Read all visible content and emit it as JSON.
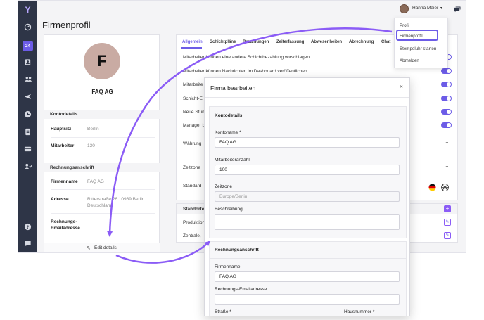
{
  "colors": {
    "accent": "#6c5ce7",
    "sidebar": "#2e3547",
    "arrow": "#8b5cf6"
  },
  "sidebar": {
    "icons": [
      "logo-icon",
      "dashboard-icon",
      "calendar-icon",
      "id-card-icon",
      "users-icon",
      "plane-icon",
      "clock-icon",
      "document-icon",
      "wallet-icon",
      "user-check-icon",
      "help-icon",
      "chat-icon"
    ],
    "calendar_label": "24"
  },
  "header": {
    "title": "Firmenprofil",
    "user_name": "Hanna Maier"
  },
  "user_menu": {
    "items": [
      "Profil",
      "Firmenprofil",
      "Stempeluhr starten",
      "Abmelden"
    ]
  },
  "profile": {
    "avatar_letter": "F",
    "company_name": "FAQ AG",
    "kontodetails": {
      "title": "Kontodetails",
      "rows": [
        {
          "key": "Hauptsitz",
          "value": "Berlin"
        },
        {
          "key": "Mitarbeiter",
          "value": "130"
        }
      ]
    },
    "rechnungsanschrift": {
      "title": "Rechnungsanschrift",
      "firmenname_key": "Firmenname",
      "firmenname_value": "FAQ AG",
      "adresse_key": "Adresse",
      "adresse_line1": "Ritterstraße 26 10969 Berlin",
      "adresse_line2": "Deutschland",
      "email_key_line1": "Rechnungs-",
      "email_key_line2": "Emailadresse"
    },
    "edit_label": "Edit details"
  },
  "tabs": [
    "Allgemein",
    "Schichtpläne",
    "Bezahlungen",
    "Zeiterfassung",
    "Abwesenheiten",
    "Abrechnung",
    "Chat"
  ],
  "settings": {
    "rows": [
      "Mitarbeiter können eine andere Schichtbezahlung vorschlagen",
      "Mitarbeiter können Nachrichten im Dashboard veröffentlichen",
      "Mitarbeite",
      "Schicht-E",
      "Neue Stun",
      "Manager b"
    ],
    "waehrung": "Währung",
    "zeitzone": "Zeitzone",
    "standard": "Standard",
    "standorte": "Standorte",
    "produktion": "Produktion",
    "zentrale": "Zentrale, I"
  },
  "modal": {
    "title": "Firma bearbeiten",
    "close": "×",
    "kontodetails_title": "Kontodetails",
    "kontoname_label": "Kontoname *",
    "kontoname_value": "FAQ AG",
    "mitarbeiteranzahl_label": "Mitarbeiteranzahl",
    "mitarbeiteranzahl_value": "100",
    "zeitzone_label": "Zeitzone",
    "zeitzone_value": "Europe/Berlin",
    "beschreibung_label": "Beschreibung",
    "rechnungsanschrift_title": "Rechnungsanschrift",
    "firmenname_label": "Firmenname",
    "firmenname_value": "FAQ AG",
    "email_label": "Rechnungs-Emailadresse",
    "strasse_label": "Straße *",
    "hausnummer_label": "Hausnummer *"
  }
}
